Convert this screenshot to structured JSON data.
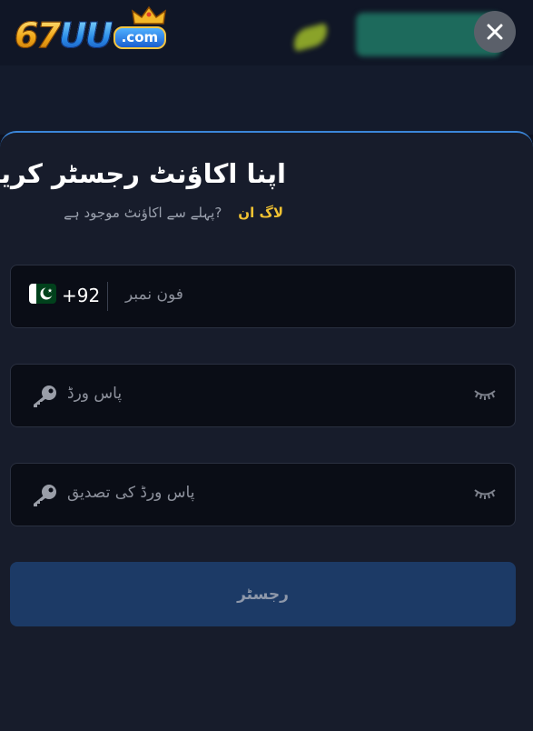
{
  "header": {
    "logo_text": "67UU",
    "logo_domain": ".com",
    "close_icon": "close-icon"
  },
  "form": {
    "title": "اپنا اکاؤنٹ رجسٹر کریں",
    "have_account": "?پہلے سے اکاؤنٹ موجود ہے",
    "login_link": "لاگ ان",
    "phone": {
      "country_flag": "pakistan-flag-icon",
      "dial_code": "+92",
      "placeholder": "فون نمبر",
      "value": ""
    },
    "password": {
      "placeholder": "پاس ورڈ",
      "value": ""
    },
    "confirm_password": {
      "placeholder": "پاس ورڈ کی تصدیق",
      "value": ""
    },
    "register_label": "رجسٹر"
  },
  "colors": {
    "accent_gold": "#f1c232",
    "sheet_border": "#3b86d9",
    "button_bg": "#1c3a66",
    "background": "#171c2b"
  }
}
